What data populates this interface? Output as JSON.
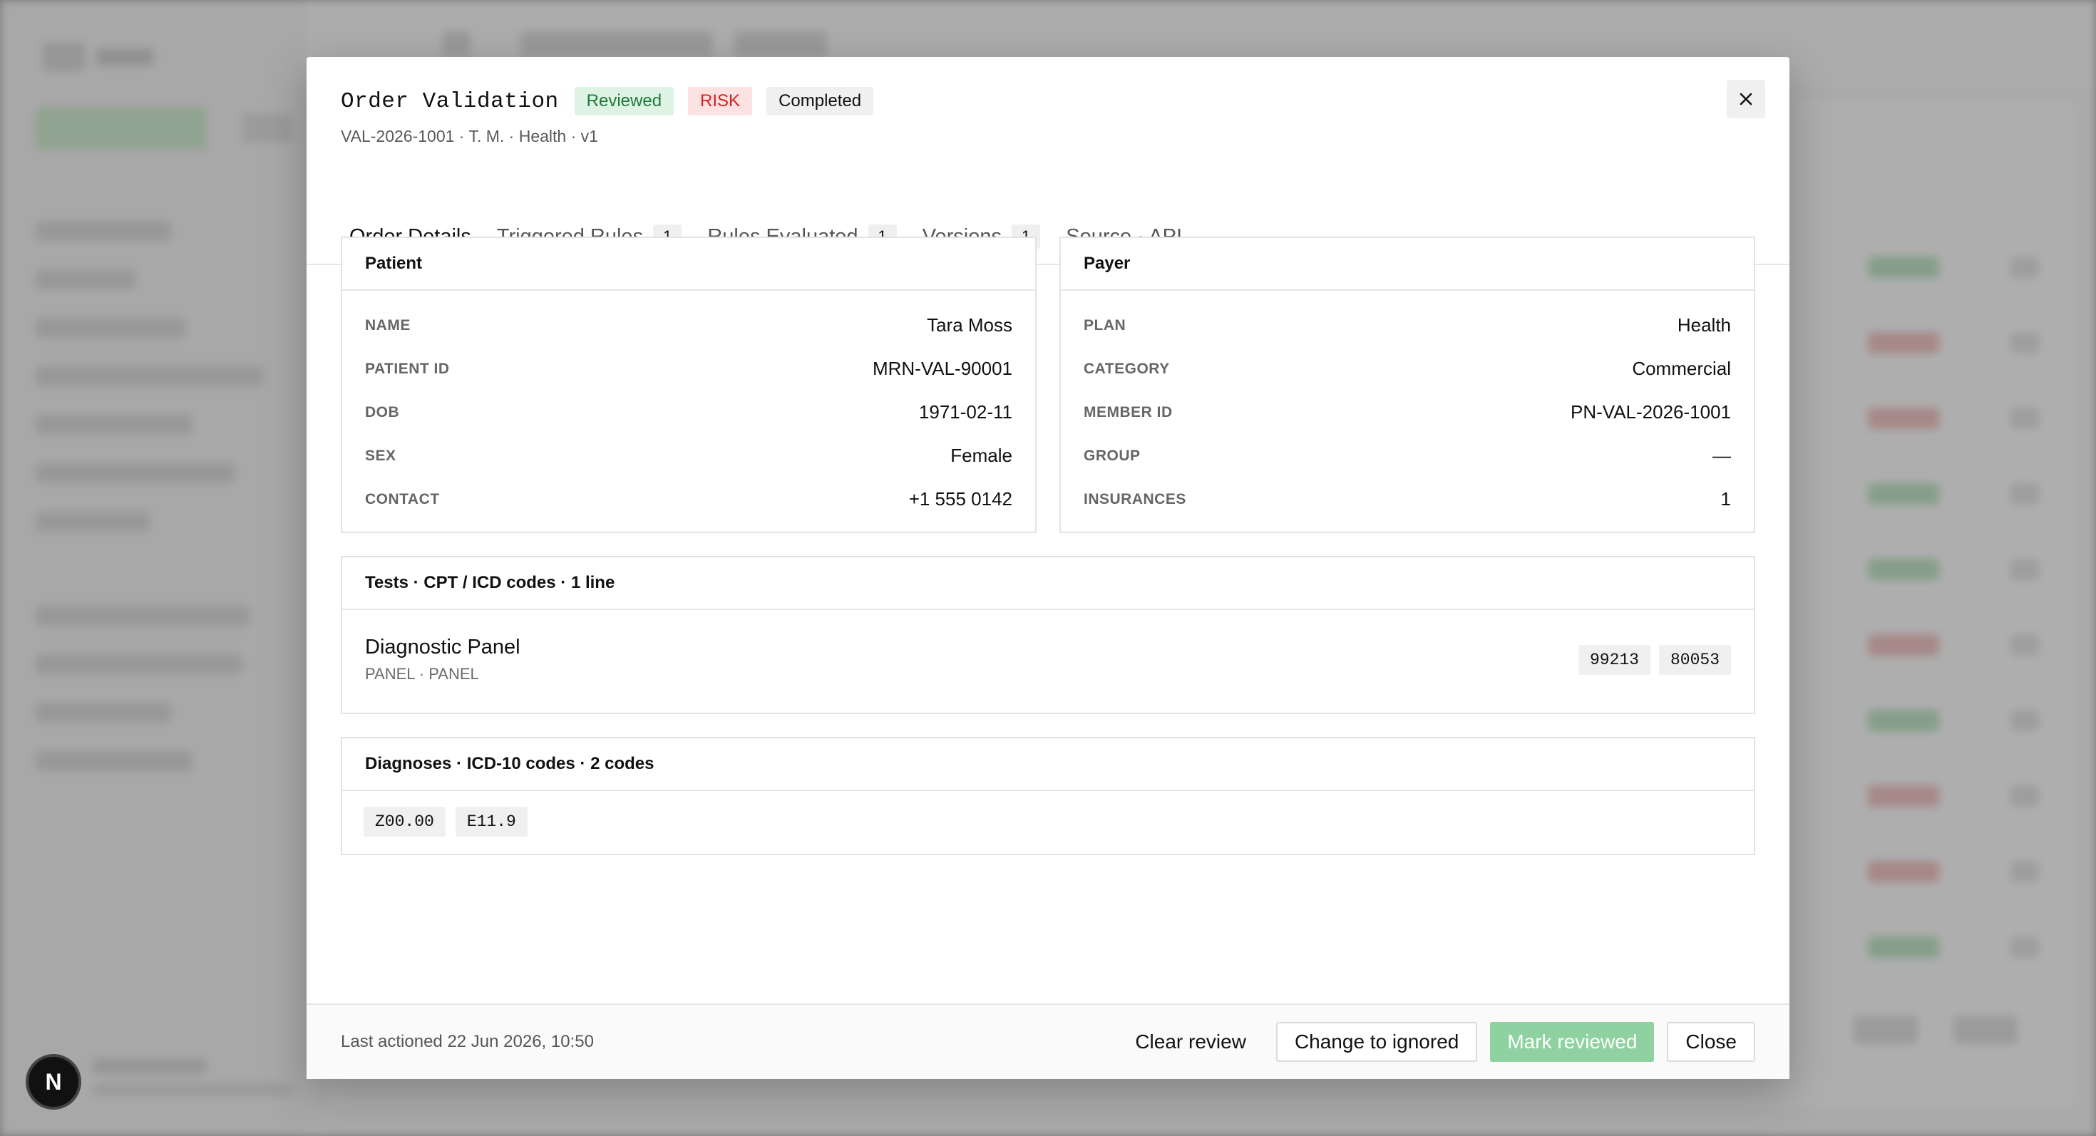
{
  "modal": {
    "title": "Order Validation",
    "badges": {
      "reviewed": "Reviewed",
      "risk": "RISK",
      "completed": "Completed"
    },
    "subtitle": "VAL-2026-1001 · T. M. · Health · v1",
    "tabs": [
      {
        "label": "Order Details",
        "count": ""
      },
      {
        "label": "Triggered Rules",
        "count": "1"
      },
      {
        "label": "Rules Evaluated",
        "count": "1"
      },
      {
        "label": "Versions",
        "count": "1"
      },
      {
        "label": "Source · API",
        "count": ""
      }
    ],
    "patient": {
      "heading": "Patient",
      "fields": [
        {
          "label": "NAME",
          "value": "Tara Moss"
        },
        {
          "label": "PATIENT ID",
          "value": "MRN-VAL-90001"
        },
        {
          "label": "DOB",
          "value": "1971-02-11"
        },
        {
          "label": "SEX",
          "value": "Female"
        },
        {
          "label": "CONTACT",
          "value": "+1 555 0142"
        }
      ]
    },
    "payer": {
      "heading": "Payer",
      "fields": [
        {
          "label": "PLAN",
          "value": "Health"
        },
        {
          "label": "CATEGORY",
          "value": "Commercial"
        },
        {
          "label": "MEMBER ID",
          "value": "PN-VAL-2026-1001"
        },
        {
          "label": "GROUP",
          "value": "—"
        },
        {
          "label": "INSURANCES",
          "value": "1"
        }
      ]
    },
    "tests": {
      "heading": "Tests · CPT / ICD codes · 1 line",
      "name": "Diagnostic Panel",
      "sub": "PANEL · PANEL",
      "codes": [
        "99213",
        "80053"
      ]
    },
    "diagnoses": {
      "heading": "Diagnoses · ICD-10 codes · 2 codes",
      "codes": [
        "Z00.00",
        "E11.9"
      ]
    },
    "footer": {
      "meta": "Last actioned 22 Jun 2026, 10:50",
      "clear_review": "Clear review",
      "change_ignored": "Change to ignored",
      "mark_reviewed": "Mark reviewed",
      "close": "Close"
    }
  },
  "floating_badge": "N",
  "colors": {
    "reviewed_bg": "#dff3e4",
    "risk_text": "#d32020",
    "mark_reviewed_bg": "#8fd1a0"
  }
}
